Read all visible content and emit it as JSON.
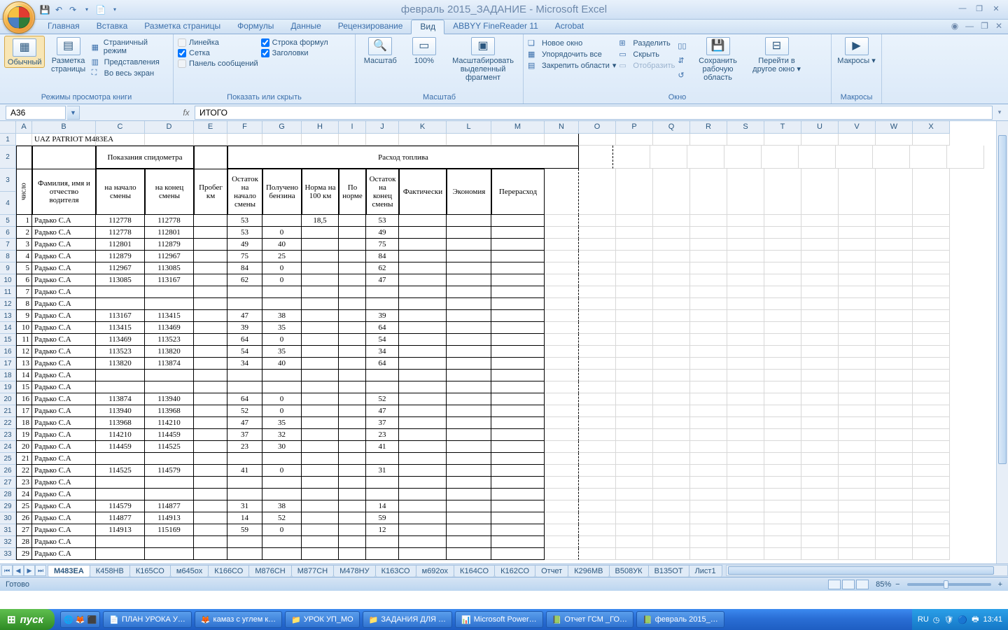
{
  "app": {
    "title": "февраль 2015_ЗАДАНИЕ - Microsoft Excel"
  },
  "qat_icons": [
    "save",
    "undo",
    "redo",
    "print"
  ],
  "ribbon_tabs": [
    "Главная",
    "Вставка",
    "Разметка страницы",
    "Формулы",
    "Данные",
    "Рецензирование",
    "Вид",
    "ABBYY FineReader 11",
    "Acrobat"
  ],
  "active_tab": "Вид",
  "ribbon": {
    "views": {
      "normal": "Обычный",
      "page_layout": "Разметка страницы",
      "pagebreak": "Страничный режим",
      "custom": "Представления",
      "fullscreen": "Во весь экран",
      "group": "Режимы просмотра книги"
    },
    "show": {
      "ruler": "Линейка",
      "gridlines": "Сетка",
      "msgbar": "Панель сообщений",
      "formula": "Строка формул",
      "headings": "Заголовки",
      "group": "Показать или скрыть"
    },
    "zoom": {
      "zoom": "Масштаб",
      "z100": "100%",
      "selection": "Масштабировать выделенный фрагмент",
      "group": "Масштаб"
    },
    "window": {
      "new": "Новое окно",
      "arrange": "Упорядочить все",
      "freeze": "Закрепить области",
      "split": "Разделить",
      "hide": "Скрыть",
      "unhide": "Отобразить",
      "save_ws": "Сохранить рабочую область",
      "switch": "Перейти в другое окно",
      "group": "Окно"
    },
    "macros": {
      "macros": "Макросы",
      "group": "Макросы"
    }
  },
  "namebox": "A36",
  "formula": "ИТОГО",
  "columns": [
    "A",
    "B",
    "C",
    "D",
    "E",
    "F",
    "G",
    "H",
    "I",
    "J",
    "K",
    "L",
    "M",
    "N",
    "O",
    "P",
    "Q",
    "R",
    "S",
    "T",
    "U",
    "V",
    "W",
    "X"
  ],
  "sheet_title": "UAZ PATRIOT  М483ЕА",
  "headers": {
    "fio": "Фамилия, имя и отчество водителя",
    "num": "число",
    "odo": "Показания спидометра",
    "odo_start": "на начало смены",
    "odo_end": "на конец смены",
    "mileage": "Пробег км",
    "fuel": "Расход топлива",
    "f_start": "Остаток на начало смены",
    "f_recv": "Получено бензина",
    "f_norm100": "Норма на 100 км",
    "f_bynorm": "По норме",
    "f_end": "Остаток на конец смены",
    "f_fact": "Фактически",
    "f_econ": "Экономия",
    "f_over": "Перерасход"
  },
  "chart_data": {
    "type": "table",
    "columns": [
      "число",
      "ФИО",
      "на начало смены",
      "на конец смены",
      "Пробег км",
      "Остаток на начало смены",
      "Получено бензина",
      "Норма на 100 км",
      "По норме",
      "Остаток на конец смены",
      "Фактически",
      "Экономия",
      "Перерасход"
    ],
    "rows": [
      [
        1,
        "Радько С.А",
        112778,
        112778,
        "",
        53,
        "",
        18.5,
        "",
        53,
        "",
        "",
        ""
      ],
      [
        2,
        "Радько С.А",
        112778,
        112801,
        "",
        53,
        0,
        "",
        "",
        49,
        "",
        "",
        ""
      ],
      [
        3,
        "Радько С.А",
        112801,
        112879,
        "",
        49,
        40,
        "",
        "",
        75,
        "",
        "",
        ""
      ],
      [
        4,
        "Радько С.А",
        112879,
        112967,
        "",
        75,
        25,
        "",
        "",
        84,
        "",
        "",
        ""
      ],
      [
        5,
        "Радько С.А",
        112967,
        113085,
        "",
        84,
        0,
        "",
        "",
        62,
        "",
        "",
        ""
      ],
      [
        6,
        "Радько С.А",
        113085,
        113167,
        "",
        62,
        0,
        "",
        "",
        47,
        "",
        "",
        ""
      ],
      [
        7,
        "Радько С.А",
        "",
        "",
        "",
        "",
        "",
        "",
        "",
        "",
        "",
        "",
        ""
      ],
      [
        8,
        "Радько С.А",
        "",
        "",
        "",
        "",
        "",
        "",
        "",
        "",
        "",
        "",
        ""
      ],
      [
        9,
        "Радько С.А",
        113167,
        113415,
        "",
        47,
        38,
        "",
        "",
        39,
        "",
        "",
        ""
      ],
      [
        10,
        "Радько С.А",
        113415,
        113469,
        "",
        39,
        35,
        "",
        "",
        64,
        "",
        "",
        ""
      ],
      [
        11,
        "Радько С.А",
        113469,
        113523,
        "",
        64,
        0,
        "",
        "",
        54,
        "",
        "",
        ""
      ],
      [
        12,
        "Радько С.А",
        113523,
        113820,
        "",
        54,
        35,
        "",
        "",
        34,
        "",
        "",
        ""
      ],
      [
        13,
        "Радько С.А",
        113820,
        113874,
        "",
        34,
        40,
        "",
        "",
        64,
        "",
        "",
        ""
      ],
      [
        14,
        "Радько С.А",
        "",
        "",
        "",
        "",
        "",
        "",
        "",
        "",
        "",
        "",
        ""
      ],
      [
        15,
        "Радько С.А",
        "",
        "",
        "",
        "",
        "",
        "",
        "",
        "",
        "",
        "",
        ""
      ],
      [
        16,
        "Радько С.А",
        113874,
        113940,
        "",
        64,
        0,
        "",
        "",
        52,
        "",
        "",
        ""
      ],
      [
        17,
        "Радько С.А",
        113940,
        113968,
        "",
        52,
        0,
        "",
        "",
        47,
        "",
        "",
        ""
      ],
      [
        18,
        "Радько С.А",
        113968,
        114210,
        "",
        47,
        35,
        "",
        "",
        37,
        "",
        "",
        ""
      ],
      [
        19,
        "Радько С.А",
        114210,
        114459,
        "",
        37,
        32,
        "",
        "",
        23,
        "",
        "",
        ""
      ],
      [
        20,
        "Радько С.А",
        114459,
        114525,
        "",
        23,
        30,
        "",
        "",
        41,
        "",
        "",
        ""
      ],
      [
        21,
        "Радько С.А",
        "",
        "",
        "",
        "",
        "",
        "",
        "",
        "",
        "",
        "",
        ""
      ],
      [
        22,
        "Радько С.А",
        114525,
        114579,
        "",
        41,
        0,
        "",
        "",
        31,
        "",
        "",
        ""
      ],
      [
        23,
        "Радько С.А",
        "",
        "",
        "",
        "",
        "",
        "",
        "",
        "",
        "",
        "",
        ""
      ],
      [
        24,
        "Радько С.А",
        "",
        "",
        "",
        "",
        "",
        "",
        "",
        "",
        "",
        "",
        ""
      ],
      [
        25,
        "Радько С.А",
        114579,
        114877,
        "",
        31,
        38,
        "",
        "",
        14,
        "",
        "",
        ""
      ],
      [
        26,
        "Радько С.А",
        114877,
        114913,
        "",
        14,
        52,
        "",
        "",
        59,
        "",
        "",
        ""
      ],
      [
        27,
        "Радько С.А",
        114913,
        115169,
        "",
        59,
        0,
        "",
        "",
        12,
        "",
        "",
        ""
      ],
      [
        28,
        "Радько С.А",
        "",
        "",
        "",
        "",
        "",
        "",
        "",
        "",
        "",
        "",
        ""
      ],
      [
        29,
        "Радько С.А",
        "",
        "",
        "",
        "",
        "",
        "",
        "",
        "",
        "",
        "",
        ""
      ]
    ]
  },
  "sheet_tabs": [
    "М483ЕА",
    "К458НВ",
    "К165СО",
    "м645ох",
    "К166СО",
    "М876СН",
    "М877СН",
    "М478НУ",
    "К163СО",
    "м692ох",
    "К164СО",
    "К162СО",
    "Отчет",
    "К296МВ",
    "В508УК",
    "В135ОТ",
    "Лист1"
  ],
  "active_sheet": "М483ЕА",
  "status": {
    "ready": "Готово",
    "zoom": "85%"
  },
  "taskbar": {
    "start": "пуск",
    "items": [
      "ПЛАН УРОКА У…",
      "камаз с углем к…",
      "УРОК УП_МО",
      "ЗАДАНИЯ ДЛЯ …",
      "Microsoft Power…",
      "Отчет ГСМ _ГО…",
      "февраль 2015_…"
    ],
    "lang": "RU",
    "clock": "13:41"
  }
}
